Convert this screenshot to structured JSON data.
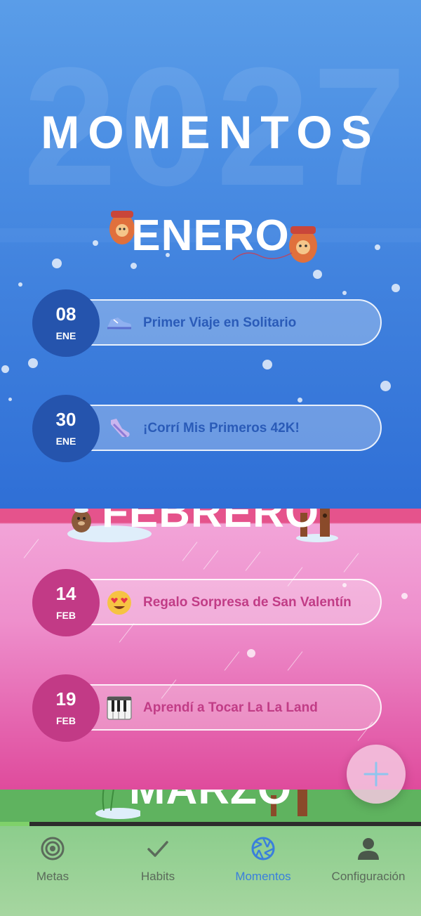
{
  "header": {
    "year_watermark": "2027",
    "title": "MOMENTOS"
  },
  "sections": [
    {
      "month": "ENERO",
      "moments": [
        {
          "day": "08",
          "month_abbr": "ENE",
          "icon": "sneaker-icon",
          "title": "Primer Viaje en Solitario"
        },
        {
          "day": "30",
          "month_abbr": "ENE",
          "icon": "running-shoe-icon",
          "title": "¡Corrí Mis Primeros 42K!"
        }
      ]
    },
    {
      "month": "FEBRERO",
      "moments": [
        {
          "day": "14",
          "month_abbr": "FEB",
          "icon": "heart-eyes-emoji-icon",
          "title": "Regalo Sorpresa de San Valentín"
        },
        {
          "day": "19",
          "month_abbr": "FEB",
          "icon": "piano-keys-icon",
          "title": "Aprendí a Tocar La La Land"
        }
      ]
    },
    {
      "month": "MARZO",
      "moments": []
    }
  ],
  "fab": {
    "icon": "plus-icon"
  },
  "scroll_progress": 0.07,
  "nav": [
    {
      "label": "Metas",
      "icon": "target-icon",
      "active": false
    },
    {
      "label": "Habits",
      "icon": "checkmark-icon",
      "active": false
    },
    {
      "label": "Momentos",
      "icon": "aperture-icon",
      "active": true
    },
    {
      "label": "Configuración",
      "icon": "user-icon",
      "active": false
    }
  ],
  "colors": {
    "january_bg": "#4b8ee3",
    "february_bg": "#ee8fcc",
    "march_bg": "#5fb35f",
    "blue_badge": "#2554ad",
    "pink_badge": "#c23a86",
    "nav_active": "#3a7fdc"
  }
}
